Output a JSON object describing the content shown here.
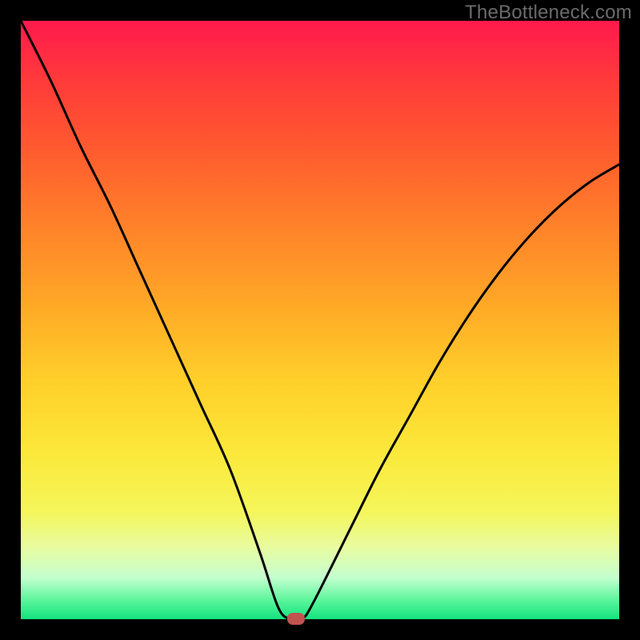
{
  "watermark": "TheBottleneck.com",
  "colors": {
    "frame": "#000000",
    "curve": "#000000",
    "marker": "#c0534f"
  },
  "chart_data": {
    "type": "line",
    "title": "",
    "xlabel": "",
    "ylabel": "",
    "xlim": [
      0,
      100
    ],
    "ylim": [
      0,
      100
    ],
    "series": [
      {
        "name": "bottleneck-curve",
        "x": [
          0,
          5,
          10,
          15,
          20,
          25,
          30,
          35,
          40,
          43,
          45,
          47,
          49,
          55,
          60,
          65,
          70,
          75,
          80,
          85,
          90,
          95,
          100
        ],
        "y": [
          100,
          90,
          79,
          69,
          58,
          47,
          36,
          25,
          11,
          2,
          0,
          0,
          3,
          15,
          25,
          34,
          43,
          51,
          58,
          64,
          69,
          73,
          76
        ]
      }
    ],
    "annotations": [
      {
        "type": "marker",
        "x": 46,
        "y": 0
      }
    ],
    "grid": false,
    "legend": false
  }
}
